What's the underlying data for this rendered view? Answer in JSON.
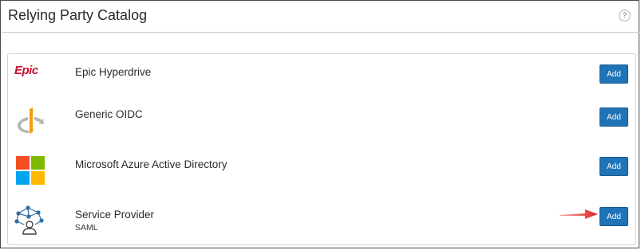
{
  "header": {
    "title": "Relying Party Catalog",
    "help_label": "?"
  },
  "catalog": {
    "items": [
      {
        "name": "Epic Hyperdrive",
        "subtitle": "",
        "logo": "epic-logo",
        "logo_text": "Epic",
        "add_label": "Add"
      },
      {
        "name": "Generic OIDC",
        "subtitle": "",
        "logo": "openid-icon",
        "add_label": "Add"
      },
      {
        "name": "Microsoft Azure Active Directory",
        "subtitle": "",
        "logo": "microsoft-logo",
        "add_label": "Add"
      },
      {
        "name": "Service Provider",
        "subtitle": "SAML",
        "logo": "service-provider-icon",
        "add_label": "Add"
      }
    ]
  },
  "annotation": {
    "arrow_color": "#e02020",
    "points_to": "service-provider-add-button"
  },
  "colors": {
    "button": "#1f73b7",
    "epic_red": "#c8102e",
    "ms_red": "#f25022",
    "ms_green": "#7fba00",
    "ms_blue": "#00a4ef",
    "ms_yellow": "#ffb900"
  }
}
